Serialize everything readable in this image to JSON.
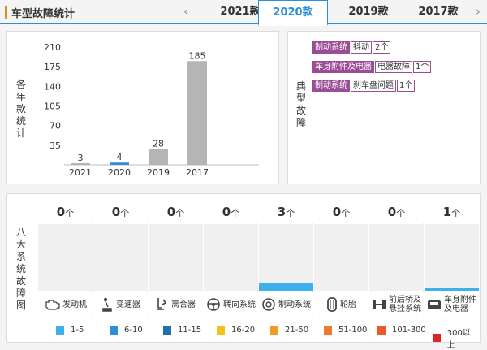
{
  "header": {
    "title": "车型故障统计",
    "prev_arrow": "‹",
    "next_arrow": "›",
    "tabs": [
      {
        "label": "2021款",
        "active": false
      },
      {
        "label": "2020款",
        "active": true
      },
      {
        "label": "2019款",
        "active": false
      },
      {
        "label": "2017款",
        "active": false
      }
    ]
  },
  "chart_panel": {
    "side_label": [
      "各",
      "年",
      "款",
      "统",
      "计"
    ],
    "chart_data": {
      "type": "bar",
      "categories": [
        "2021",
        "2020",
        "2019",
        "2017"
      ],
      "values": [
        3,
        4,
        28,
        185
      ],
      "data_labels": [
        "3",
        "4",
        "28",
        "185"
      ],
      "yticks": [
        "35",
        "70",
        "105",
        "140",
        "175",
        "210"
      ],
      "ylim": [
        0,
        210
      ],
      "bar_colors": [
        "#b5b5b5",
        "#2d8fd8",
        "#b5b5b5",
        "#b5b5b5"
      ],
      "grid": false,
      "legend": "none"
    }
  },
  "typical_panel": {
    "side_label": [
      "典",
      "型",
      "故",
      "障"
    ],
    "faults": [
      {
        "system": "制动系统",
        "detail": "抖动",
        "count": "2个"
      },
      {
        "system": "车身附件及电器",
        "detail": "电器故障",
        "count": "1个"
      },
      {
        "system": "制动系统",
        "detail": "刹车盘问题",
        "count": "1个"
      }
    ]
  },
  "systems_panel": {
    "side_label": [
      "八",
      "大",
      "系",
      "统",
      "故",
      "障",
      "图"
    ],
    "unit": "个",
    "fill_color": "#3eb0ee",
    "max_value": 10,
    "systems": [
      {
        "name": "发动机",
        "count": "0",
        "value": 0,
        "icon": "engine-icon"
      },
      {
        "name": "变速器",
        "count": "0",
        "value": 0,
        "icon": "gear-shift-icon"
      },
      {
        "name": "离合器",
        "count": "0",
        "value": 0,
        "icon": "clutch-pedal-icon"
      },
      {
        "name": "转向系统",
        "count": "0",
        "value": 0,
        "icon": "steering-wheel-icon"
      },
      {
        "name": "制动系统",
        "count": "3",
        "value": 3,
        "icon": "brake-disc-icon"
      },
      {
        "name": "轮胎",
        "count": "0",
        "value": 0,
        "icon": "tire-icon"
      },
      {
        "name": "前后桥及悬挂系统",
        "name_lines": [
          "前后桥及",
          "悬挂系统"
        ],
        "count": "0",
        "value": 0,
        "icon": "suspension-icon"
      },
      {
        "name": "车身附件及电器",
        "name_lines": [
          "车身附件",
          "及电器"
        ],
        "count": "1",
        "value": 1,
        "icon": "car-body-icon"
      }
    ],
    "legend": [
      {
        "label": "1-5",
        "color": "#3eb0ee"
      },
      {
        "label": "6-10",
        "color": "#2d8fd8"
      },
      {
        "label": "11-15",
        "color": "#1e6fae"
      },
      {
        "label": "16-20",
        "color": "#f4c020"
      },
      {
        "label": "21-50",
        "color": "#f09a28"
      },
      {
        "label": "51-100",
        "color": "#ec7a30"
      },
      {
        "label": "101-300",
        "color": "#e85a2c"
      },
      {
        "label": "300以上",
        "color": "#e02424"
      }
    ]
  }
}
